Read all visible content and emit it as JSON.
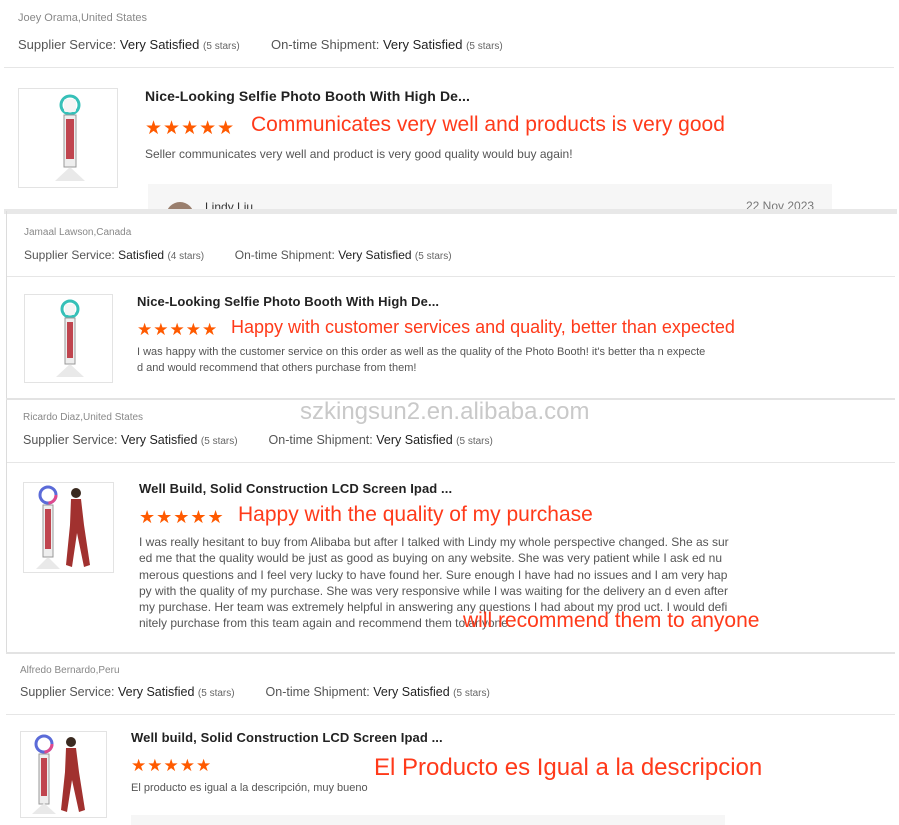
{
  "watermark": "szkingsun2.en.alibaba.com",
  "labels": {
    "supplier_service": "Supplier Service:",
    "ontime_shipment": "On-time Shipment:"
  },
  "reviews": [
    {
      "reviewer": "Joey Orama,United States",
      "supplier_rating": "Very Satisfied",
      "supplier_stars": "(5 stars)",
      "shipment_rating": "Very Satisfied",
      "shipment_stars": "(5 stars)",
      "product_title": "Nice-Looking Selfie Photo Booth With High De...",
      "stars": "★★★★★",
      "headline": "Communicates very well and products is very good",
      "body": "Seller communicates very well and product is very good quality would buy again!",
      "reply_author": "Lindy Liu",
      "reply_date": "22 Nov 2023"
    },
    {
      "reviewer": "Jamaal Lawson,Canada",
      "supplier_rating": "Satisfied",
      "supplier_stars": "(4 stars)",
      "shipment_rating": "Very Satisfied",
      "shipment_stars": "(5 stars)",
      "product_title": "Nice-Looking Selfie Photo Booth With High De...",
      "stars": "★★★★★",
      "headline": "Happy with customer services and quality, better than expected",
      "body": "I was happy with the customer service on this order as well as the quality of the Photo Booth! it's better tha n expected and would recommend that others purchase from them!"
    },
    {
      "reviewer": "Ricardo Diaz,United States",
      "supplier_rating": "Very Satisfied",
      "supplier_stars": "(5 stars)",
      "shipment_rating": "Very Satisfied",
      "shipment_stars": "(5 stars)",
      "product_title": "Well Build, Solid Construction LCD Screen Ipad ...",
      "stars": "★★★★★",
      "headline": "Happy with the quality of my purchase",
      "body": "I was really hesitant to buy from Alibaba but after I talked with Lindy my whole perspective changed. She as sured me that the quality would be just as good as buying on any website. She was very patient while I ask ed numerous questions and I feel very lucky to have found her. Sure enough I have had no issues and I am very happy with the quality of my purchase. She was very responsive while I was waiting for the delivery an d even after my purchase. Her team was extremely helpful in answering any questions I had about my prod uct. I would definitely purchase from this team again and recommend them to anyone.",
      "overlay": "will recommend them to anyone"
    },
    {
      "reviewer": "Alfredo Bernardo,Peru",
      "supplier_rating": "Very Satisfied",
      "supplier_stars": "(5 stars)",
      "shipment_rating": "Very Satisfied",
      "shipment_stars": "(5 stars)",
      "product_title": "Well build, Solid Construction LCD Screen Ipad ...",
      "stars": "★★★★★",
      "headline": "El Producto es Igual a la descripcion",
      "body": "El producto es igual a la descripción, muy bueno"
    }
  ]
}
